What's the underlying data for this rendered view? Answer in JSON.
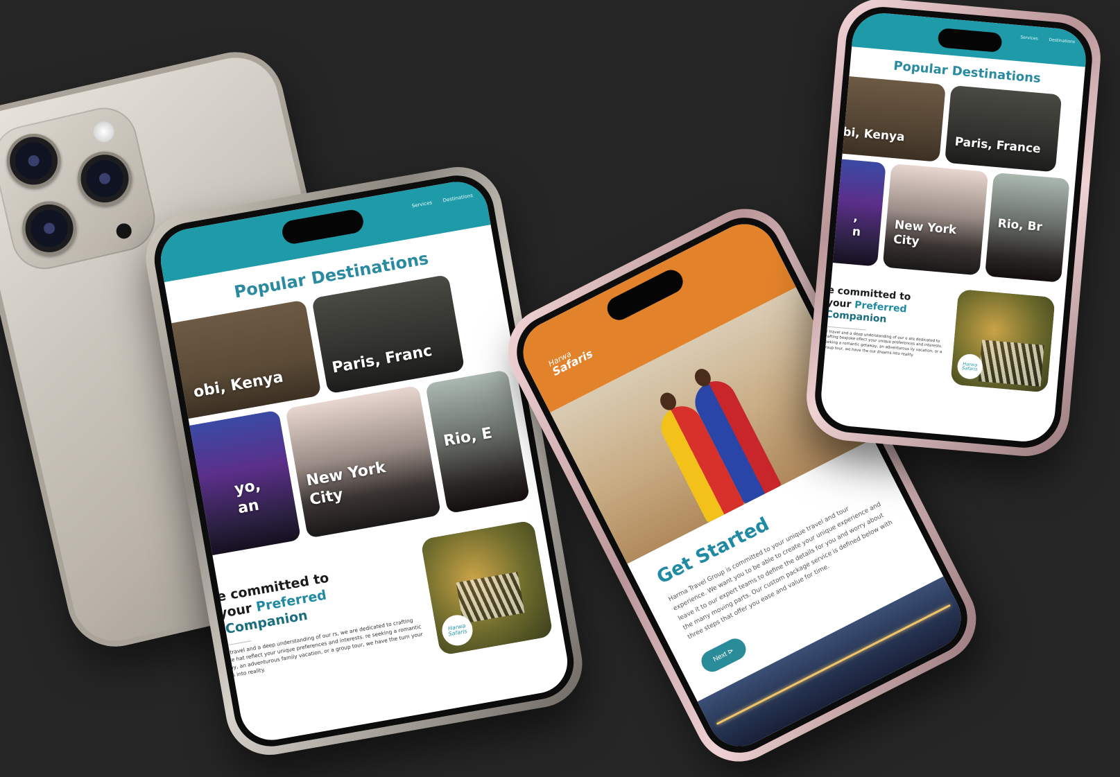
{
  "colors": {
    "teal": "#1f9aa8",
    "title_teal": "#2a8ba0",
    "orange": "#e2822a",
    "background": "#262626"
  },
  "phoneA": {
    "nav": [
      "Services",
      "Destinations"
    ],
    "section_title": "Popular Destinations",
    "destinations_row1": [
      "obi, Kenya",
      "Paris, Franc"
    ],
    "destinations_row2": [
      "yo,\nan",
      "New York\nCity",
      "Rio, E"
    ],
    "committed_line1": "are committed to",
    "committed_line2_prefix": "g your",
    "committed_line2_accent": "Preferred",
    "committed_line3": "el Companion",
    "committed_body": "ion for travel and a deep understanding of our rs, we are dedicated to crafting bespoke hat reflect your unique preferences and interests. re seeking a romantic getaway, an adventurous family vacation, or a group tour, we have the turn your dreams into reality.",
    "badge": "Harwa Safaris"
  },
  "phoneB": {
    "logo_top": "Harwa",
    "logo_bottom": "Safaris",
    "heading": "Get Started",
    "body": "Harma Travel Group is committed to your unique travel and tour experience. We want you to be able to create your unique experience and leave it to our expert teams to define the details for you and worry about the many moving parts. Our custom package service is defined below with three steps that offer you ease and value for time.",
    "next_label": "Next ⊳"
  },
  "phoneC": {
    "nav": [
      "Services",
      "Destinations"
    ],
    "section_title": "Popular Destinations",
    "destinations_row1": [
      "bi, Kenya",
      "Paris, France"
    ],
    "destinations_row2": [
      ",\nn",
      "New York\nCity",
      "Rio, Br"
    ],
    "committed_line1": "e committed to",
    "committed_line2_prefix": "your",
    "committed_line2_accent": "Preferred",
    "committed_line3": "Companion",
    "committed_body": "or travel and a deep understanding of our e are dedicated to crafting bespoke eflect your unique preferences and interests. seeking a romantic getaway, an adventurous ily vacation, or a group tour, we have the our dreams into reality.",
    "badge": "Harwa Safaris"
  }
}
